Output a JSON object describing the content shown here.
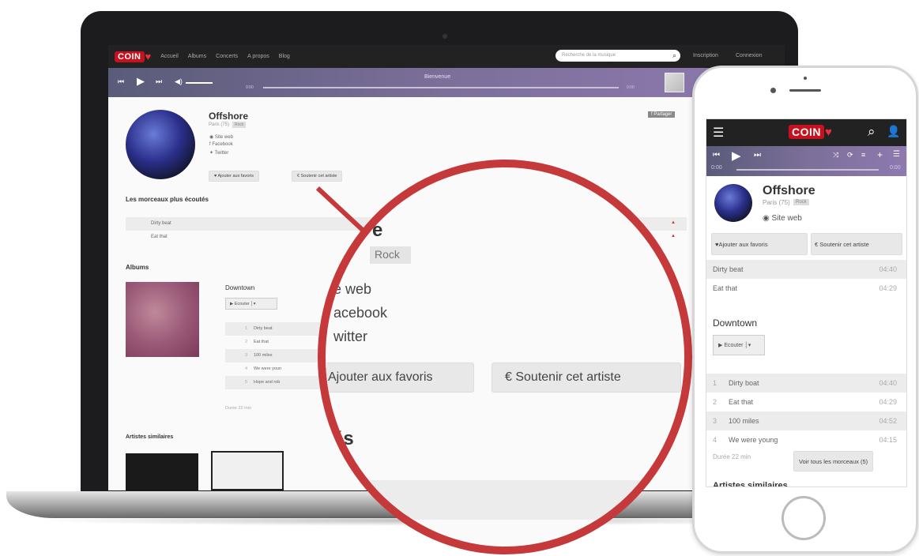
{
  "desktop": {
    "brand": "COIN",
    "nav": [
      "Accueil",
      "Albums",
      "Concerts",
      "A propos",
      "Blog"
    ],
    "search_placeholder": "Recherche de la musique",
    "nav_right": [
      "Inscription",
      "Connexion"
    ],
    "player": {
      "track_title": "Bienvenue",
      "time_start": "0:00",
      "time_end": "0:00"
    },
    "artist": {
      "name": "Offshore",
      "location": "Paris (75)",
      "tag": "Rock",
      "links": [
        "Site web",
        "Facebook",
        "Twitter"
      ],
      "add_favorite": "Ajouter aux favoris",
      "support": "Soutenir cet artiste",
      "share": "Partager"
    },
    "popular_heading": "Les morceaux plus écoutés",
    "popular_tracks": [
      "Dirty beat",
      "Eat that"
    ],
    "albums_heading": "Albums",
    "album": {
      "title": "Downtown",
      "listen": "Ecouter",
      "tracks": [
        {
          "n": "1",
          "title": "Dirty beat"
        },
        {
          "n": "2",
          "title": "Eat that"
        },
        {
          "n": "3",
          "title": "100 miles"
        },
        {
          "n": "4",
          "title": "We were youn"
        },
        {
          "n": "5",
          "title": "Hope and rob"
        }
      ],
      "duration": "Durée 22 min"
    },
    "similar_heading": "Artistes similaires"
  },
  "magnifier": {
    "heading_letter": "e",
    "tag": "Rock",
    "links": [
      "e web",
      "acebook",
      "witter"
    ],
    "add_favorite": "Ajouter aux favoris",
    "support": "Soutenir cet artiste",
    "euro": "€",
    "section_fragment": "és"
  },
  "phone": {
    "brand": "COIN",
    "time_start": "0:00",
    "time_end": "0:00",
    "artist": {
      "name": "Offshore",
      "location": "Paris (75)",
      "tag": "Rock",
      "site": "Site web"
    },
    "add_favorite": "Ajouter aux favoris",
    "support": "Soutenir cet artiste",
    "popular": [
      {
        "title": "Dirty beat",
        "dur": "04:40"
      },
      {
        "title": "Eat that",
        "dur": "04:29"
      }
    ],
    "album": {
      "title": "Downtown",
      "listen": "Ecouter",
      "tracks": [
        {
          "n": "1",
          "title": "Dirty boat",
          "dur": "04:40"
        },
        {
          "n": "2",
          "title": "Eat that",
          "dur": "04:29"
        },
        {
          "n": "3",
          "title": "100 miles",
          "dur": "04:52"
        },
        {
          "n": "4",
          "title": "We were young",
          "dur": "04:15"
        }
      ],
      "duration": "Durée 22 min",
      "see_all": "Voir tous les morceaux (5)"
    },
    "similar_heading": "Artistes similaires"
  },
  "colors": {
    "accent": "#c5393b",
    "brand": "#c8101e",
    "player": "#7c6f99"
  }
}
